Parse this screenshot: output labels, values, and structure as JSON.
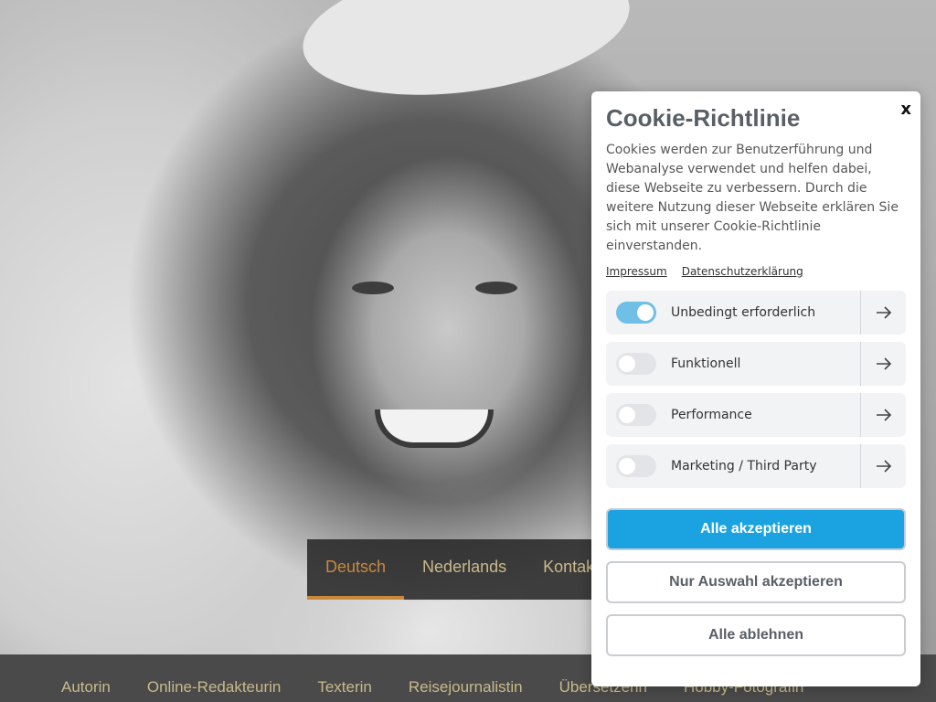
{
  "language_tabs": [
    {
      "label": "Deutsch",
      "active": true
    },
    {
      "label": "Nederlands",
      "active": false
    },
    {
      "label": "Kontakt",
      "active": false
    }
  ],
  "bottom_nav": [
    "Autorin",
    "Online-Redakteurin",
    "Texterin",
    "Reisejournalistin",
    "Übersetzerin",
    "Hobby-Fotografin"
  ],
  "cookie_modal": {
    "close_label": "x",
    "title": "Cookie-Richtlinie",
    "text": "Cookies werden zur Benutzerführung und Webanalyse verwendet und helfen dabei, diese Webseite zu verbessern. Durch die weitere Nutzung dieser Webseite erklären Sie sich mit unserer Cookie-Richtlinie einverstanden.",
    "links": {
      "impressum": "Impressum",
      "privacy": "Datenschutzerklärung"
    },
    "categories": [
      {
        "label": "Unbedingt erforderlich",
        "enabled": true
      },
      {
        "label": "Funktionell",
        "enabled": false
      },
      {
        "label": "Performance",
        "enabled": false
      },
      {
        "label": "Marketing / Third Party",
        "enabled": false
      }
    ],
    "buttons": {
      "accept_all": "Alle akzeptieren",
      "accept_selection": "Nur Auswahl akzeptieren",
      "reject_all": "Alle ablehnen"
    }
  },
  "colors": {
    "accent_blue": "#1ba3e1",
    "toggle_on": "#6fbfe6",
    "nav_text": "#c9b98a",
    "active_tab": "#c8893a"
  },
  "icons": {
    "category_arrow": "arrow-right-icon",
    "close": "close-icon"
  }
}
